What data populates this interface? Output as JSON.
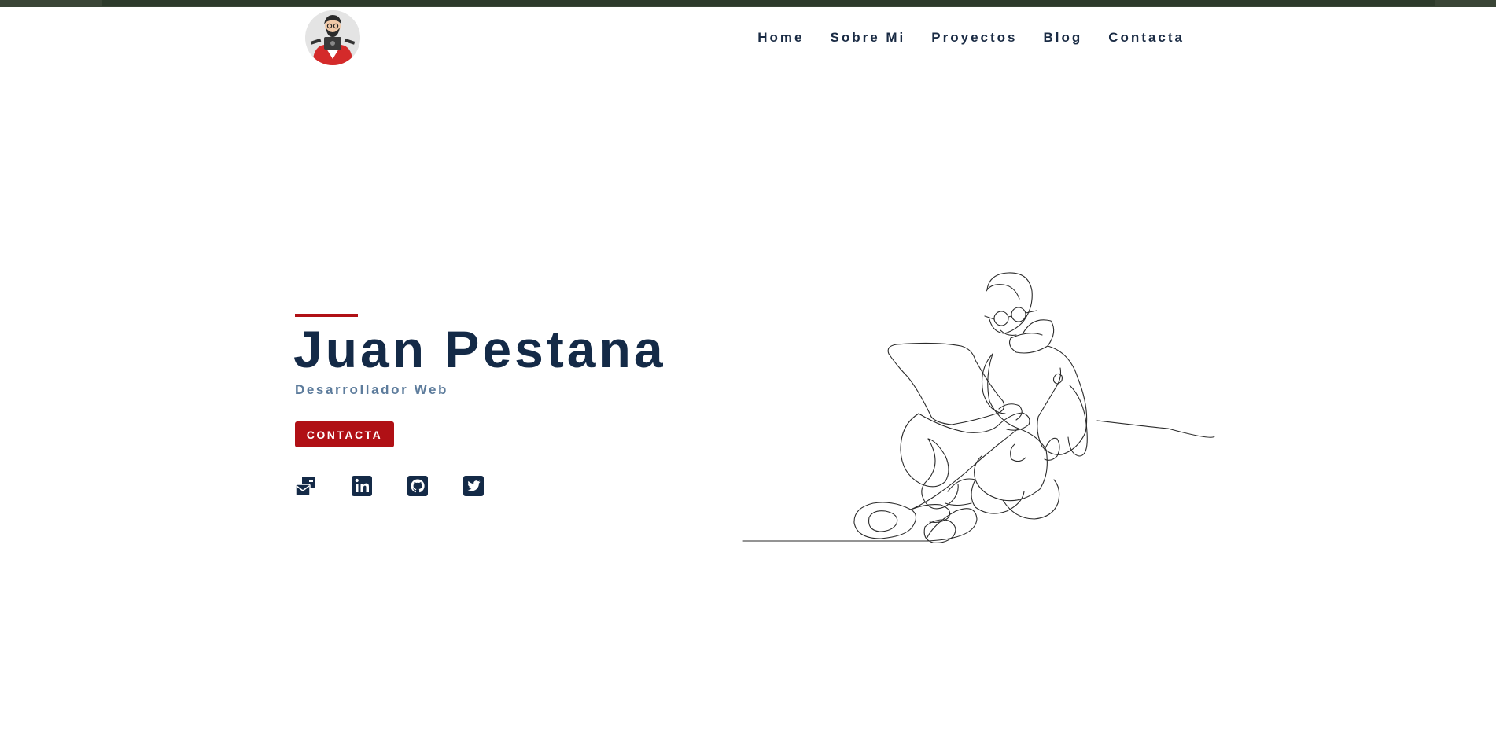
{
  "nav": {
    "items": [
      "Home",
      "Sobre Mi",
      "Proyectos",
      "Blog",
      "Contacta"
    ]
  },
  "hero": {
    "name": "Juan Pestana",
    "role": "Desarrollador Web",
    "cta_label": "CONTACTA"
  },
  "socials": [
    {
      "icon": "mail-icon"
    },
    {
      "icon": "linkedin-icon"
    },
    {
      "icon": "github-icon"
    },
    {
      "icon": "twitter-icon"
    }
  ],
  "colors": {
    "accent": "#b01015",
    "title": "#142a47",
    "subtitle": "#5d7c9c",
    "top_bar": "#2d3a2b"
  }
}
